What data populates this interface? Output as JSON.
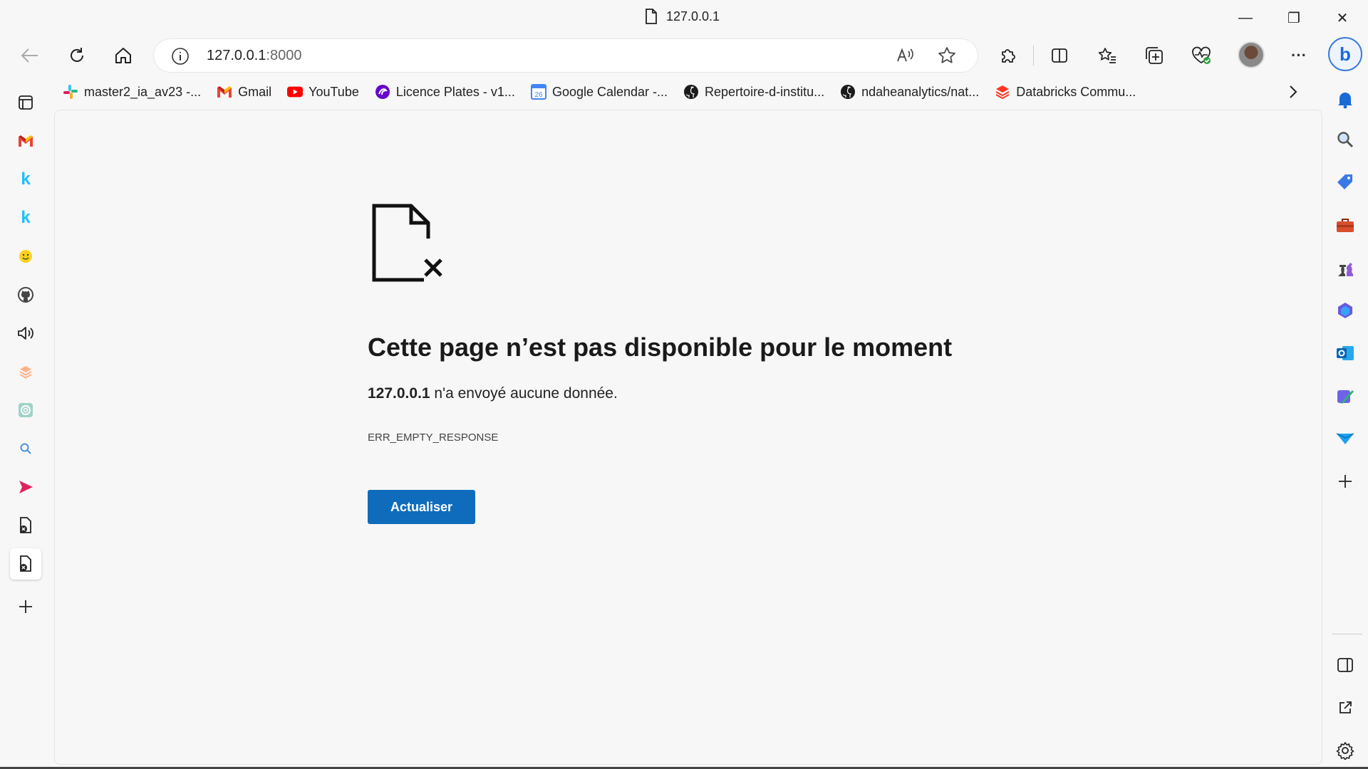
{
  "window": {
    "title": "127.0.0.1",
    "minimize": "—",
    "restore": "❐",
    "close": "✕"
  },
  "toolbar": {
    "url_host": "127.0.0.1",
    "url_port": ":8000",
    "more": "···"
  },
  "bookmarks": [
    {
      "label": "master2_ia_av23 -...",
      "icon": "slack-icon"
    },
    {
      "label": "Gmail",
      "icon": "gmail-icon"
    },
    {
      "label": "YouTube",
      "icon": "youtube-icon"
    },
    {
      "label": "Licence Plates - v1...",
      "icon": "roboflow-icon"
    },
    {
      "label": "Google Calendar -...",
      "icon": "calendar-icon"
    },
    {
      "label": "Repertoire-d-institu...",
      "icon": "github-icon"
    },
    {
      "label": "ndaheanalytics/nat...",
      "icon": "github-icon"
    },
    {
      "label": "Databricks Commu...",
      "icon": "databricks-icon"
    }
  ],
  "calendar_day": "26",
  "error": {
    "title": "Cette page n’est pas disponible pour le moment",
    "host": "127.0.0.1",
    "message": " n'a envoyé aucune donnée.",
    "code": "ERR_EMPTY_RESPONSE",
    "button": "Actualiser"
  },
  "colors": {
    "accent": "#0f6cbd",
    "background": "#f7f7f7"
  }
}
